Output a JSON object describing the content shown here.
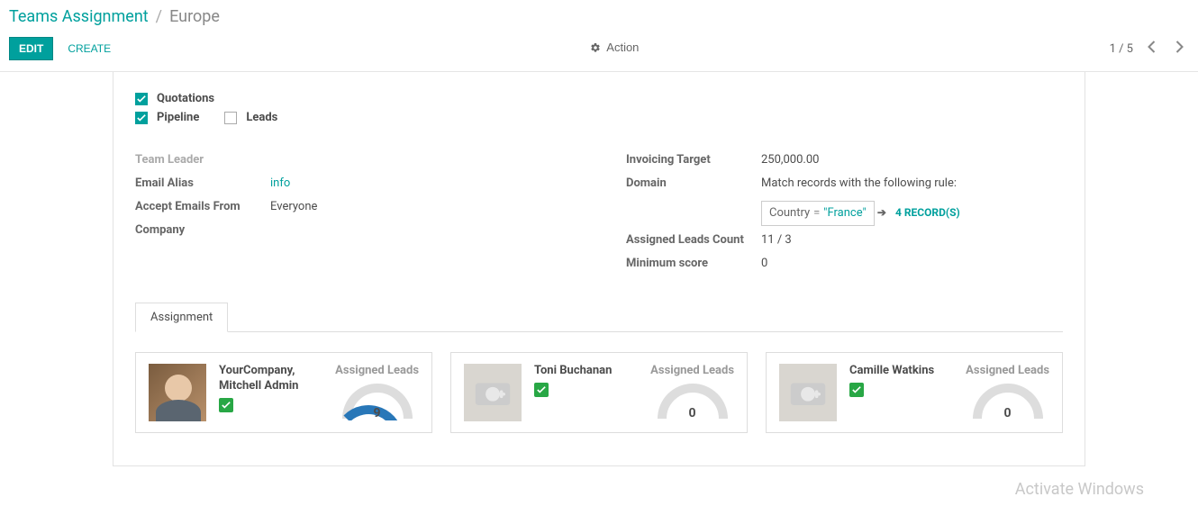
{
  "breadcrumb": {
    "parent": "Teams Assignment",
    "current": "Europe"
  },
  "toolbar": {
    "edit": "EDIT",
    "create": "CREATE",
    "action": "Action",
    "pager": "1 / 5"
  },
  "options": {
    "quotations": "Quotations",
    "pipeline": "Pipeline",
    "leads": "Leads"
  },
  "left": {
    "team_leader_label": "Team Leader",
    "email_alias_label": "Email Alias",
    "email_alias_value": "info",
    "accept_from_label": "Accept Emails From",
    "accept_from_value": "Everyone",
    "company_label": "Company"
  },
  "right": {
    "invoicing_target_label": "Invoicing Target",
    "invoicing_target_value": "250,000.00",
    "domain_label": "Domain",
    "domain_desc": "Match records with the following rule:",
    "rule_field": "Country",
    "rule_op": "=",
    "rule_value": "\"France\"",
    "records_link": "4 RECORD(S)",
    "assigned_leads_label": "Assigned Leads Count",
    "assigned_leads_value": "11 / 3",
    "min_score_label": "Minimum score",
    "min_score_value": "0"
  },
  "tabs": {
    "assignment": "Assignment"
  },
  "cards_leads_label": "Assigned Leads",
  "members": [
    {
      "name": "YourCompany, Mitchell Admin",
      "leads": "9",
      "has_photo": true,
      "gauge_fill": 0.75
    },
    {
      "name": "Toni Buchanan",
      "leads": "0",
      "has_photo": false,
      "gauge_fill": 0
    },
    {
      "name": "Camille Watkins",
      "leads": "0",
      "has_photo": false,
      "gauge_fill": 0
    }
  ],
  "watermark": "Activate Windows"
}
